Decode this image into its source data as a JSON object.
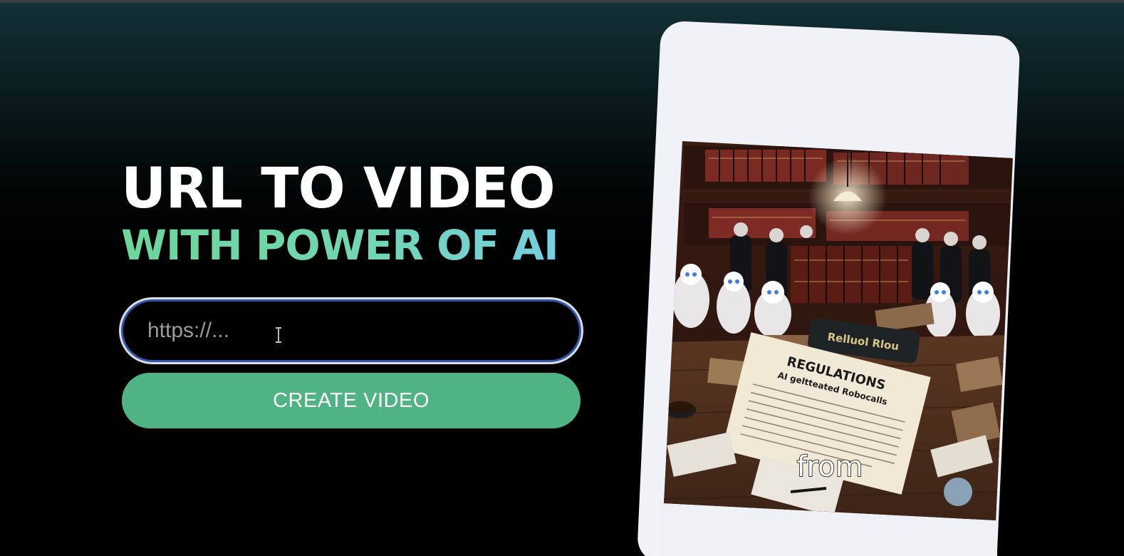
{
  "hero": {
    "title_line1": "URL TO VIDEO",
    "title_line2": "WITH POWER OF AI"
  },
  "form": {
    "url_placeholder": "https://...",
    "url_value": "",
    "submit_label": "CREATE VIDEO"
  },
  "preview": {
    "book_spine_text": "Relluol Rlou",
    "document_heading": "REGULATIONS",
    "document_subheading": "AI geltteated Robocalls",
    "caption": "from"
  },
  "colors": {
    "accent_green": "#4fb383",
    "title_gradient_start": "#6cd69a",
    "title_gradient_end": "#77cfe2",
    "input_focus_ring": "#2f56a8"
  },
  "icons": {
    "text_cursor": "i-beam-cursor-icon"
  }
}
